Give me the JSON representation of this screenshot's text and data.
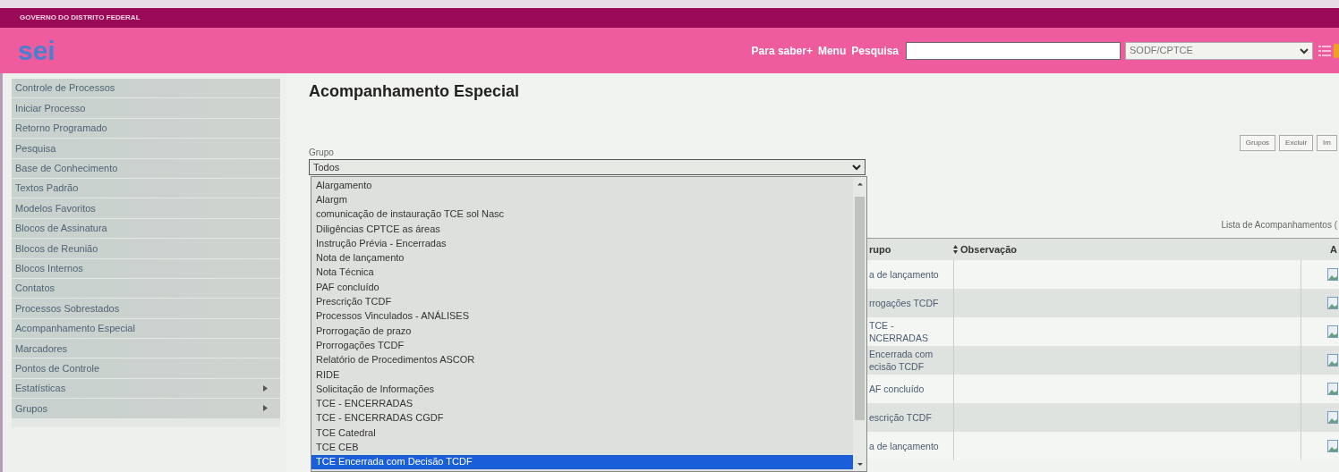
{
  "top_bar": {
    "title": "GOVERNO DO DISTRITO FEDERAL"
  },
  "header": {
    "logo": "sei",
    "links": [
      "Para saber+",
      "Menu",
      "Pesquisa"
    ],
    "unit_select": {
      "value": "SODF/CPTCE"
    }
  },
  "sidebar": {
    "items": [
      {
        "label": "Controle de Processos",
        "has_submenu": false
      },
      {
        "label": "Iniciar Processo",
        "has_submenu": false
      },
      {
        "label": "Retorno Programado",
        "has_submenu": false
      },
      {
        "label": "Pesquisa",
        "has_submenu": false
      },
      {
        "label": "Base de Conhecimento",
        "has_submenu": false
      },
      {
        "label": "Textos Padrão",
        "has_submenu": false
      },
      {
        "label": "Modelos Favoritos",
        "has_submenu": false
      },
      {
        "label": "Blocos de Assinatura",
        "has_submenu": false
      },
      {
        "label": "Blocos de Reunião",
        "has_submenu": false
      },
      {
        "label": "Blocos Internos",
        "has_submenu": false
      },
      {
        "label": "Contatos",
        "has_submenu": false
      },
      {
        "label": "Processos Sobrestados",
        "has_submenu": false
      },
      {
        "label": "Acompanhamento Especial",
        "has_submenu": false
      },
      {
        "label": "Marcadores",
        "has_submenu": false
      },
      {
        "label": "Pontos de Controle",
        "has_submenu": false
      },
      {
        "label": "Estatísticas",
        "has_submenu": true
      },
      {
        "label": "Grupos",
        "has_submenu": true
      }
    ]
  },
  "page": {
    "title": "Acompanhamento Especial",
    "buttons": [
      "Grupos",
      "Excluir",
      "Im"
    ],
    "group_field": {
      "label": "Grupo",
      "value": "Todos",
      "expanded": true,
      "options": [
        {
          "label": "Alargamento",
          "selected": false
        },
        {
          "label": "Alargm",
          "selected": false
        },
        {
          "label": "comunicação de instauração TCE sol Nasc",
          "selected": false
        },
        {
          "label": "Diligências CPTCE as áreas",
          "selected": false
        },
        {
          "label": "Instrução Prévia - Encerradas",
          "selected": false
        },
        {
          "label": "Nota de lançamento",
          "selected": false
        },
        {
          "label": "Nota Técnica",
          "selected": false
        },
        {
          "label": "PAF concluído",
          "selected": false
        },
        {
          "label": "Prescrição TCDF",
          "selected": false
        },
        {
          "label": "Processos Vinculados - ANÁLISES",
          "selected": false
        },
        {
          "label": "Prorrogação de prazo",
          "selected": false
        },
        {
          "label": "Prorrogações TCDF",
          "selected": false
        },
        {
          "label": "Relatório de Procedimentos ASCOR",
          "selected": false
        },
        {
          "label": "RIDE",
          "selected": false
        },
        {
          "label": "Solicitação de Informações",
          "selected": false
        },
        {
          "label": "TCE - ENCERRADAS",
          "selected": false
        },
        {
          "label": "TCE - ENCERRADAS CGDF",
          "selected": false
        },
        {
          "label": "TCE Catedral",
          "selected": false
        },
        {
          "label": "TCE CEB",
          "selected": false
        },
        {
          "label": "TCE Encerrada com Decisão TCDF",
          "selected": true
        }
      ]
    }
  },
  "list": {
    "caption": "Lista de Acompanhamentos (",
    "columns": [
      "rupo",
      "Observação",
      "A"
    ],
    "rows": [
      {
        "group": "a de lançamento"
      },
      {
        "group": "rrogações TCDF"
      },
      {
        "group": "TCE - NCERRADAS"
      },
      {
        "group": "Encerrada com ecisão TCDF"
      },
      {
        "group": "AF concluído"
      },
      {
        "group": "escrição TCDF"
      },
      {
        "group": "a de lançamento"
      }
    ]
  }
}
